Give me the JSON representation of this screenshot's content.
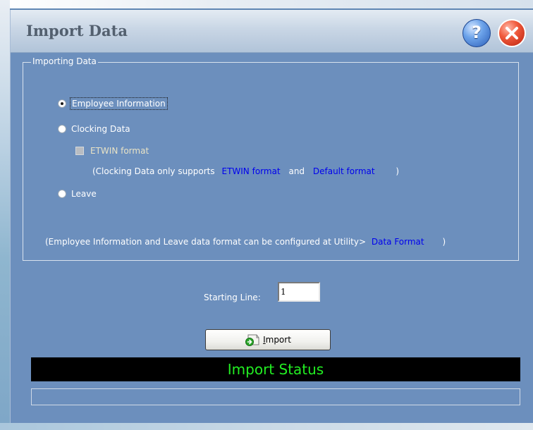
{
  "window": {
    "title": "Import Data",
    "help_label": "?"
  },
  "group": {
    "label": "Importing Data",
    "options": {
      "employee": "Employee Information",
      "clocking": "Clocking Data",
      "leave": "Leave"
    },
    "selected": "Employee Information",
    "etwin_checkbox": {
      "label": "ETWIN format",
      "checked": false,
      "enabled": false
    },
    "clocking_note": {
      "prefix": "(Clocking Data only supports",
      "link1": "ETWIN format",
      "middle": "and",
      "link2": "Default format",
      "suffix": ")"
    },
    "config_note": {
      "prefix": "(Employee Information and Leave data format can be configured at Utility>",
      "link": "Data Format",
      "suffix": ")"
    }
  },
  "starting_line": {
    "label": "Starting Line:",
    "value": "1"
  },
  "import_button": {
    "label": "Import",
    "underlined_char": "I",
    "rest": "mport"
  },
  "status": {
    "text": "Import Status"
  },
  "progress": {
    "value": 0
  },
  "colors": {
    "dialog_bg": "#6c8fbd",
    "status_bg": "#000000",
    "status_text": "#22ee22",
    "link": "#0000ee"
  },
  "icons": {
    "help": "help-icon",
    "close": "close-icon",
    "import": "import-icon"
  }
}
